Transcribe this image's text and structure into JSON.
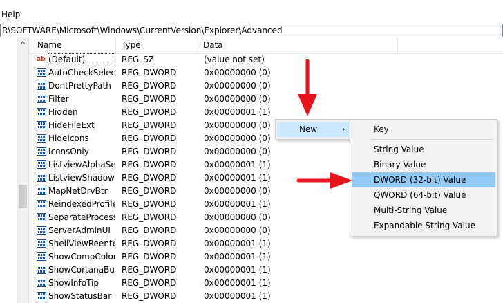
{
  "menubar": {
    "help": "Help"
  },
  "address": {
    "path": "R\\SOFTWARE\\Microsoft\\Windows\\CurrentVersion\\Explorer\\Advanced"
  },
  "columns": {
    "name": "Name",
    "type": "Type",
    "data": "Data"
  },
  "rows": [
    {
      "name": "(Default)",
      "type": "REG_SZ",
      "data": "(value not set)",
      "icon": "string-value-icon",
      "icon_text": "ab"
    },
    {
      "name": "AutoCheckSelect",
      "type": "REG_DWORD",
      "data": "0x00000000 (0)",
      "icon": "dword-value-icon"
    },
    {
      "name": "DontPrettyPath",
      "type": "REG_DWORD",
      "data": "0x00000000 (0)",
      "icon": "dword-value-icon"
    },
    {
      "name": "Filter",
      "type": "REG_DWORD",
      "data": "0x00000000 (0)",
      "icon": "dword-value-icon"
    },
    {
      "name": "Hidden",
      "type": "REG_DWORD",
      "data": "0x00000001 (1)",
      "icon": "dword-value-icon"
    },
    {
      "name": "HideFileExt",
      "type": "REG_DWORD",
      "data": "0x00000000 (0)",
      "icon": "dword-value-icon"
    },
    {
      "name": "HideIcons",
      "type": "REG_DWORD",
      "data": "0x00000000 (0)",
      "icon": "dword-value-icon"
    },
    {
      "name": "IconsOnly",
      "type": "REG_DWORD",
      "data": "0x00000000 (0)",
      "icon": "dword-value-icon"
    },
    {
      "name": "ListviewAlphaSe...",
      "type": "REG_DWORD",
      "data": "0x00000001 (1)",
      "icon": "dword-value-icon"
    },
    {
      "name": "ListviewShadow",
      "type": "REG_DWORD",
      "data": "0x00000001 (1)",
      "icon": "dword-value-icon"
    },
    {
      "name": "MapNetDrvBtn",
      "type": "REG_DWORD",
      "data": "0x00000000 (0)",
      "icon": "dword-value-icon"
    },
    {
      "name": "ReindexedProfile",
      "type": "REG_DWORD",
      "data": "0x00000001 (1)",
      "icon": "dword-value-icon"
    },
    {
      "name": "SeparateProcess",
      "type": "REG_DWORD",
      "data": "0x00000000 (0)",
      "icon": "dword-value-icon"
    },
    {
      "name": "ServerAdminUI",
      "type": "REG_DWORD",
      "data": "0x00000000 (0)",
      "icon": "dword-value-icon"
    },
    {
      "name": "ShellViewReente...",
      "type": "REG_DWORD",
      "data": "0x00000001 (1)",
      "icon": "dword-value-icon"
    },
    {
      "name": "ShowCompColor",
      "type": "REG_DWORD",
      "data": "0x00000001 (1)",
      "icon": "dword-value-icon"
    },
    {
      "name": "ShowCortanaBu...",
      "type": "REG_DWORD",
      "data": "0x00000001 (1)",
      "icon": "dword-value-icon"
    },
    {
      "name": "ShowInfoTip",
      "type": "REG_DWORD",
      "data": "0x00000001 (1)",
      "icon": "dword-value-icon"
    },
    {
      "name": "ShowStatusBar",
      "type": "REG_DWORD",
      "data": "0x00000001 (1)",
      "icon": "dword-value-icon"
    }
  ],
  "context_menu": {
    "new_label": "New",
    "submenu_arrow": "›",
    "submenu": [
      {
        "label": "Key"
      },
      {
        "label": "String Value"
      },
      {
        "label": "Binary Value"
      },
      {
        "label": "DWORD (32-bit) Value",
        "highlighted": true
      },
      {
        "label": "QWORD (64-bit) Value"
      },
      {
        "label": "Multi-String Value"
      },
      {
        "label": "Expandable String Value"
      }
    ]
  },
  "annotations": {
    "arrow_color": "#e8121c"
  },
  "colors": {
    "menu_hover": "#cce8ff",
    "menu_highlight": "#91c9f7",
    "dword_icon_blue": "#1f4e9c"
  }
}
